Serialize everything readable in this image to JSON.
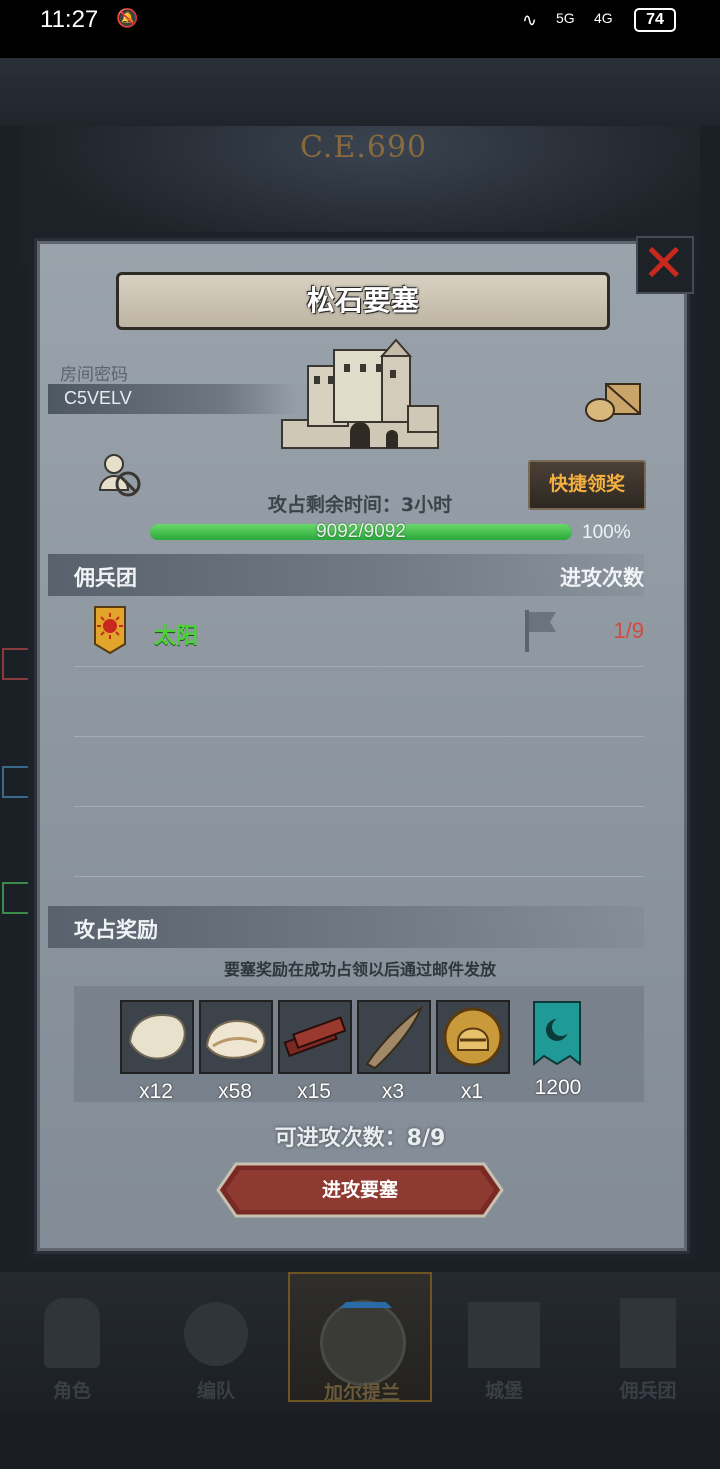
{
  "status_bar": {
    "time": "11:27",
    "signal_1": "5G",
    "signal_2": "4G",
    "battery": "74"
  },
  "background": {
    "era_label": "C.E.690"
  },
  "dialog": {
    "title": "松石要塞",
    "room_code_label": "房间密码",
    "room_code": "C5VELV",
    "quick_claim_button": "快捷领奖",
    "remaining_time": "攻占剩余时间：3小时",
    "hp": {
      "text": "9092/9092",
      "percent_text": "100%",
      "fraction": 1.0
    },
    "mercenary_section": {
      "left_header": "佣兵团",
      "right_header": "进攻次数",
      "rows": [
        {
          "name": "太阳",
          "attacks": "1/9"
        }
      ]
    },
    "reward_section": {
      "header": "攻占奖励",
      "notice": "要塞奖励在成功占领以后通过邮件发放",
      "items": [
        {
          "icon": "hide-icon",
          "quantity": "x12"
        },
        {
          "icon": "fur-icon",
          "quantity": "x58"
        },
        {
          "icon": "wood-planks-icon",
          "quantity": "x15"
        },
        {
          "icon": "horn-icon",
          "quantity": "x3"
        },
        {
          "icon": "golden-helmet-icon",
          "quantity": "x1"
        },
        {
          "icon": "banner-icon",
          "quantity": "1200"
        }
      ]
    },
    "attack_count": "可进攻次数：8/9",
    "attack_button": "进攻要塞"
  },
  "bottom_nav": {
    "items": [
      {
        "label": "角色"
      },
      {
        "label": "编队"
      },
      {
        "label": "加尔提兰"
      },
      {
        "label": "城堡"
      },
      {
        "label": "佣兵团"
      }
    ],
    "active_index": 2
  },
  "colors": {
    "accent_gold": "#f3b040",
    "hp_green": "#2aa83a",
    "close_red": "#c8281e",
    "attack_count_red": "#d24a3c",
    "guild_name_green": "#4fcf3b"
  }
}
